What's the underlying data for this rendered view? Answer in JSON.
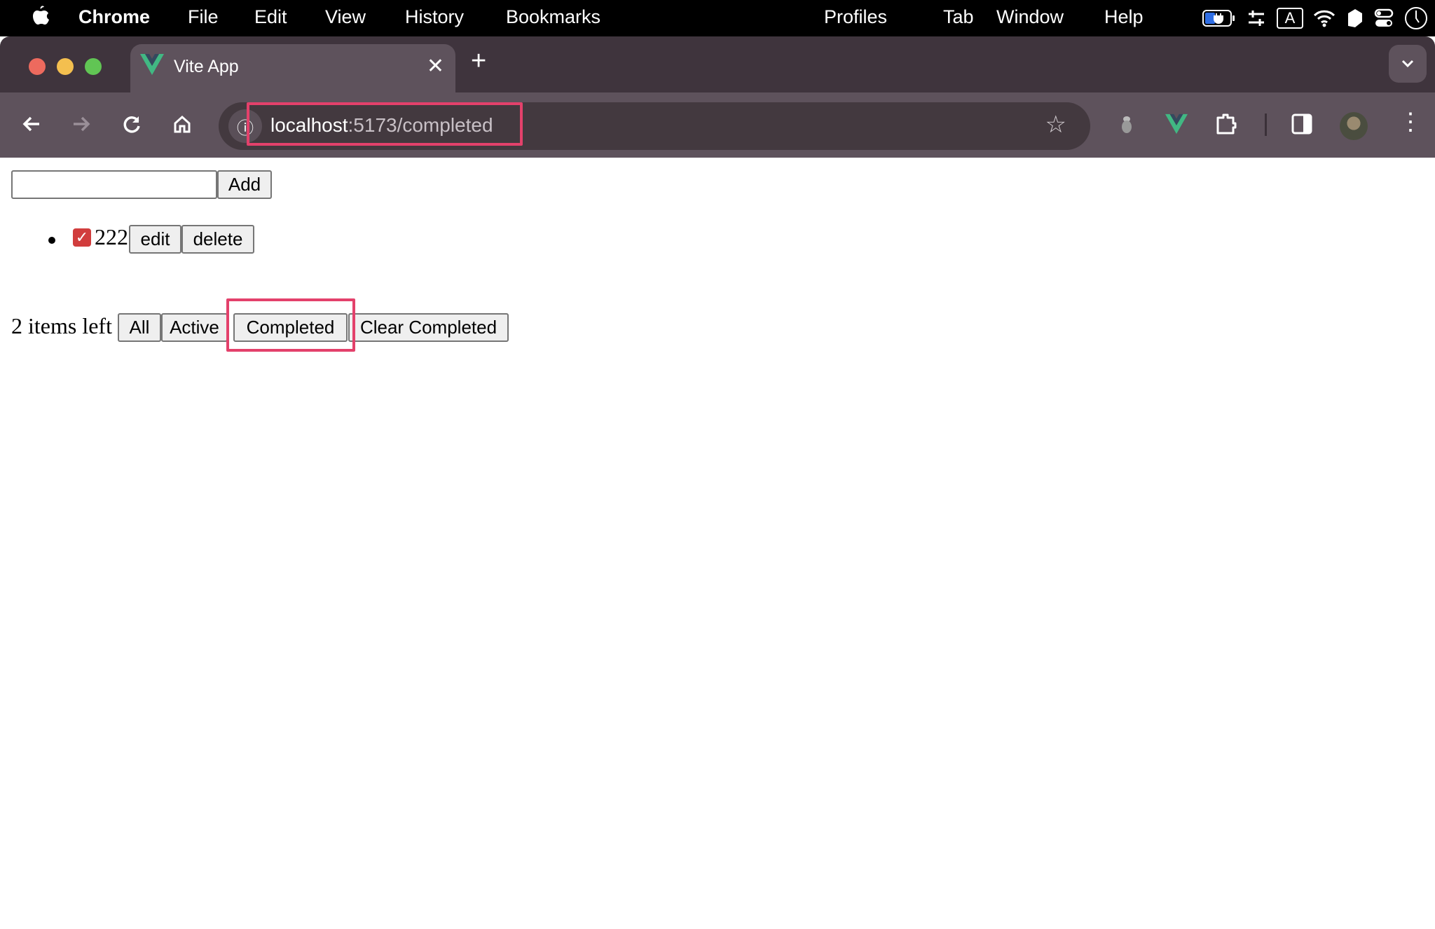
{
  "menubar": {
    "app_name": "Chrome",
    "items": [
      "File",
      "Edit",
      "View",
      "History",
      "Bookmarks",
      "Profiles",
      "Tab",
      "Window",
      "Help"
    ],
    "status_icons": [
      "battery-charging-icon",
      "control-sliders-icon",
      "input-source-icon",
      "wifi-icon",
      "app-tag-icon",
      "control-center-icon",
      "clock-icon"
    ],
    "input_source_label": "A"
  },
  "browser": {
    "tab": {
      "title": "Vite App",
      "close_glyph": "✕"
    },
    "new_tab_glyph": "+",
    "tab_search_glyph": "⌄",
    "nav": {
      "back": "←",
      "forward": "→",
      "reload": "↻",
      "home": "⌂"
    },
    "url": {
      "host": "localhost",
      "rest": ":5173/completed"
    },
    "star_glyph": "☆",
    "menu_glyph": "⋮",
    "accent_highlight": "#e3416b"
  },
  "app": {
    "new_todo": {
      "value": "",
      "placeholder": ""
    },
    "add_label": "Add",
    "todos": [
      {
        "text": "222",
        "completed": true,
        "edit_label": "edit",
        "delete_label": "delete"
      }
    ],
    "footer": {
      "items_left": "2 items left",
      "filters": [
        "All",
        "Active",
        "Completed"
      ],
      "active_filter": "Completed",
      "clear_label": "Clear Completed"
    }
  }
}
